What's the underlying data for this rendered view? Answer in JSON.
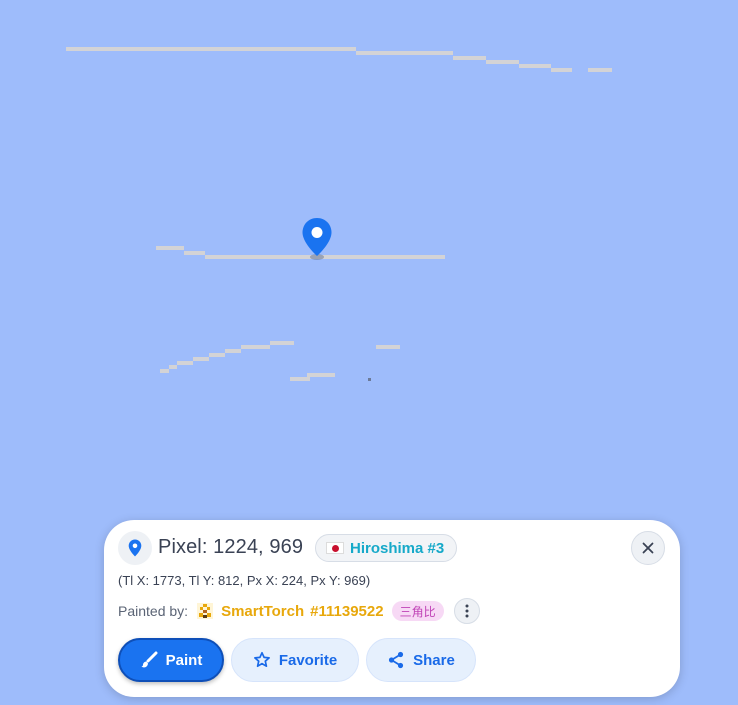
{
  "map": {
    "background": "#9ebcfb",
    "stroke_color": "#d3d3d6",
    "marker_icon": "map-pin-icon",
    "marker_color": "#1a73f0"
  },
  "pixel_card": {
    "title": "Pixel: 1224, 969",
    "region": {
      "flag_icon": "japan-flag-icon",
      "label": "Hiroshima #3"
    },
    "close_icon": "close-icon",
    "coordinates": "(Tl X: 1773, Tl Y: 812, Px X: 224, Px Y: 969)",
    "painted_by": {
      "label": "Painted by:",
      "avatar_icon": "pixel-avatar-icon",
      "user_name": "SmartTorch",
      "user_id": "#11139522",
      "tag": "三角比",
      "more_icon": "more-vertical-icon"
    },
    "actions": {
      "paint": {
        "label": "Paint",
        "icon": "paint-brush-icon"
      },
      "favorite": {
        "label": "Favorite",
        "icon": "star-icon"
      },
      "share": {
        "label": "Share",
        "icon": "share-icon"
      }
    }
  },
  "colors": {
    "accent": "#1a73f0",
    "region_text": "#16a9c9",
    "user_text": "#e8a80c",
    "tag_text": "#c043b6",
    "tag_bg": "#f7d9f5"
  }
}
